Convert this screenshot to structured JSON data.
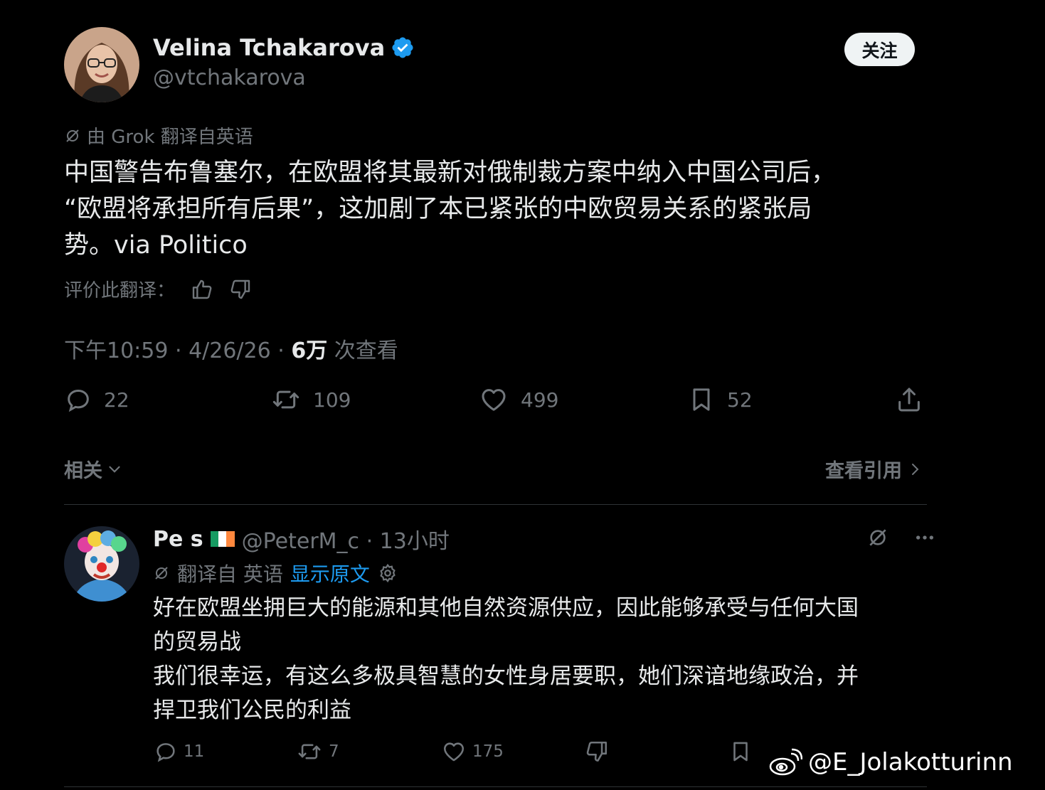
{
  "tweet": {
    "author_name": "Velina Tchakarova",
    "author_handle": "@vtchakarova",
    "follow_label": "关注",
    "translated_by": "由 Grok 翻译自英语",
    "text": "中国警告布鲁塞尔，在欧盟将其最新对俄制裁方案中纳入中国公司后，\n“欧盟将承担所有后果”，这加剧了本已紧张的中欧贸易关系的紧张局\n势。via Politico",
    "rate_label": "评价此翻译：",
    "time": "下午10:59 · 4/26/26 · ",
    "views_count": "6万",
    "views_label": " 次查看",
    "actions": {
      "replies": "22",
      "reposts": "109",
      "likes": "499",
      "bookmarks": "52"
    },
    "related_label": "相关",
    "view_quotes_label": "查看引用"
  },
  "reply": {
    "name": "Pe     s",
    "handle_time": "@PeterM_c · 13小时",
    "translated_from": "翻译自 英语",
    "show_original": "显示原文",
    "text": "好在欧盟坐拥巨大的能源和其他自然资源供应，因此能够承受与任何大国\n的贸易战\n我们很幸运，有这么多极具智慧的女性身居要职，她们深谙地缘政治，并\n捍卫我们公民的利益",
    "actions": {
      "replies": "11",
      "reposts": "7",
      "likes": "175"
    }
  },
  "watermark": "@E_Jolakotturinn",
  "colors": {
    "background": "#000000",
    "text": "#e7e9ea",
    "muted": "#71767b",
    "accent": "#1d9bf0",
    "verified": "#1d9bf0"
  },
  "icons": [
    "verified-badge-icon",
    "translate-icon",
    "thumbs-up-icon",
    "thumbs-down-icon",
    "reply-icon",
    "repost-icon",
    "like-icon",
    "bookmark-icon",
    "share-icon",
    "chevron-down-icon",
    "chevron-right-icon",
    "settings-icon",
    "more-icon",
    "weibo-icon"
  ]
}
